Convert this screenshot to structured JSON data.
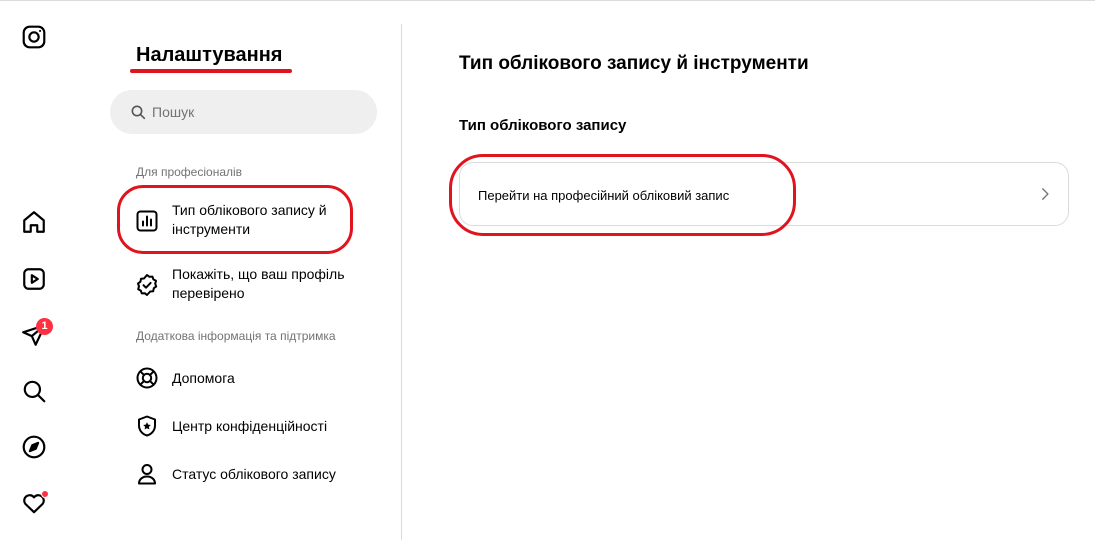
{
  "rail": {
    "icons": [
      "instagram-icon",
      "home-icon",
      "reels-icon",
      "messages-icon",
      "search-icon",
      "explore-icon",
      "notifications-icon"
    ],
    "messages_badge": "1"
  },
  "settings": {
    "title": "Налаштування",
    "search_placeholder": "Пошук",
    "section_pro": "Для професіоналів",
    "items_pro": [
      {
        "label": "Тип облікового запису й інструменти",
        "icon": "bar-chart-icon"
      },
      {
        "label": "Покажіть, що ваш профіль перевірено",
        "icon": "verified-badge-icon"
      }
    ],
    "section_support": "Додаткова інформація та підтримка",
    "items_support": [
      {
        "label": "Допомога",
        "icon": "lifebuoy-icon"
      },
      {
        "label": "Центр конфіденційності",
        "icon": "shield-icon"
      },
      {
        "label": "Статус облікового запису",
        "icon": "person-icon"
      }
    ]
  },
  "main": {
    "title": "Тип облікового запису й інструменти",
    "subtitle": "Тип облікового запису",
    "switch_label": "Перейти на професійний обліковий запис"
  },
  "colors": {
    "annotation": "#e0141e",
    "badge": "#ff3040",
    "border": "#dbdbdb",
    "search_bg": "#efefef",
    "muted_text": "#737373"
  }
}
